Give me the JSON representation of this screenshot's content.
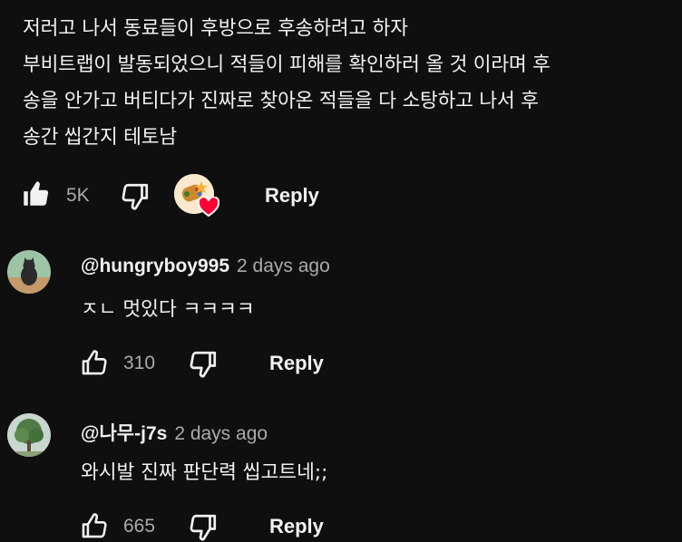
{
  "comment": {
    "lines": [
      "저러고 나서 동료들이 후방으로 후송하려고 하자",
      "부비트랩이 발동되었으니 적들이 피해를 확인하러 올 것 이라며 후",
      "송을 안가고 버티다가 진짜로 찾아온 적들을 다 소탕하고 나서 후",
      "송간 씹간지 테토남"
    ],
    "like_count": "5K",
    "reply_label": "Reply",
    "icons": {
      "like": "thumbs-up-filled-icon",
      "dislike": "thumbs-down-icon",
      "creator_heart": "creator-heart-icon"
    }
  },
  "replies": [
    {
      "handle": "@hungryboy995",
      "time": "2 days ago",
      "text": "ㅈㄴ 멋있다 ㅋㅋㅋㅋ",
      "like_count": "310",
      "reply_label": "Reply"
    },
    {
      "handle": "@나무-j7s",
      "time": "2 days ago",
      "text": "와시발 진짜 판단력 씹고트네;;",
      "like_count": "665",
      "reply_label": "Reply"
    }
  ],
  "colors": {
    "background": "#0f0f0f",
    "text": "#f1f1f1",
    "secondary_text": "#aaaaaa",
    "heart": "#ff0033"
  }
}
